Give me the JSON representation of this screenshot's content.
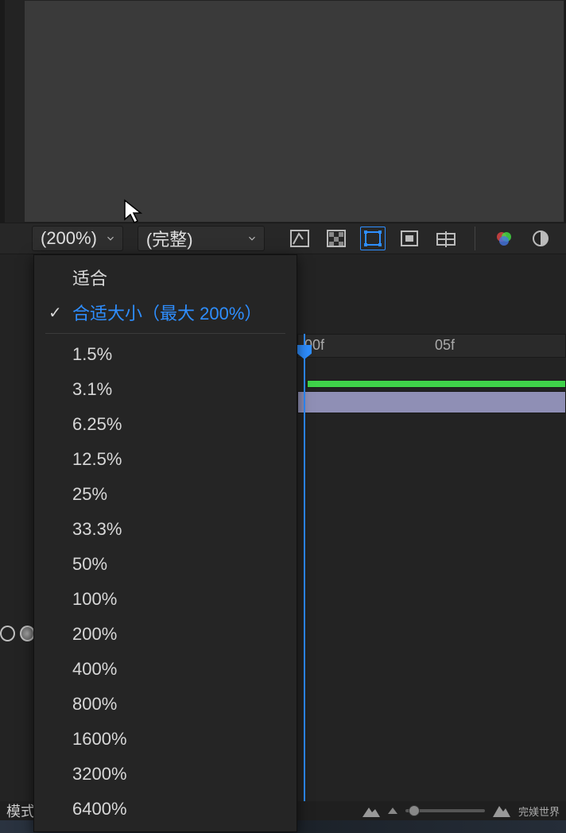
{
  "toolbar": {
    "zoom_value": "(200%)",
    "resolution_value": "(完整)"
  },
  "zoom_menu": {
    "fit": "适合",
    "fit_max": "合适大小（最大 200%）",
    "levels": [
      "1.5%",
      "3.1%",
      "6.25%",
      "12.5%",
      "25%",
      "33.3%",
      "50%",
      "100%",
      "200%",
      "400%",
      "800%",
      "1600%",
      "3200%",
      "6400%"
    ]
  },
  "timeline": {
    "tick_00f": "00f",
    "tick_05f": "05f"
  },
  "bottom": {
    "mode_label": "模式",
    "watermark": "完媄世界"
  }
}
